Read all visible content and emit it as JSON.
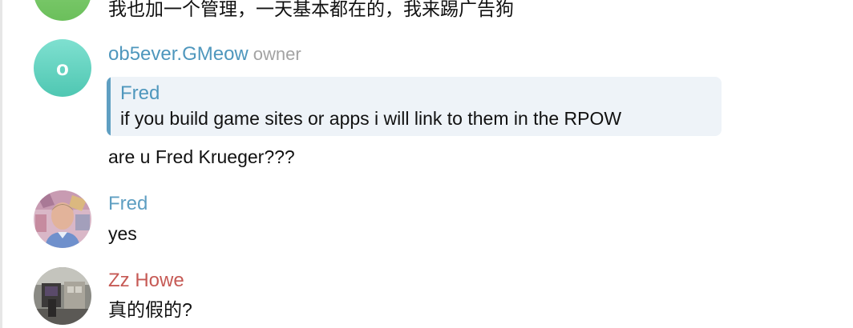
{
  "colors": {
    "owner_name": "#4f97bd",
    "fred_name": "#5f9fc2",
    "zz_name": "#c65a55",
    "quote_background": "#eef3f8",
    "quote_bar": "#5f9fc2"
  },
  "messages": [
    {
      "text": "我也加一个管理，一天基本都在的，我来踢广告狗"
    },
    {
      "avatar_letter": "o",
      "name": "ob5ever.GMeow",
      "role": "owner",
      "reply_to_name": "Fred",
      "reply_to_text": "if you build game sites or apps i will link to them in the RPOW",
      "text": "are u Fred Krueger???"
    },
    {
      "name": "Fred",
      "text": "yes"
    },
    {
      "name": "Zz Howe",
      "text": "真的假的?"
    }
  ]
}
